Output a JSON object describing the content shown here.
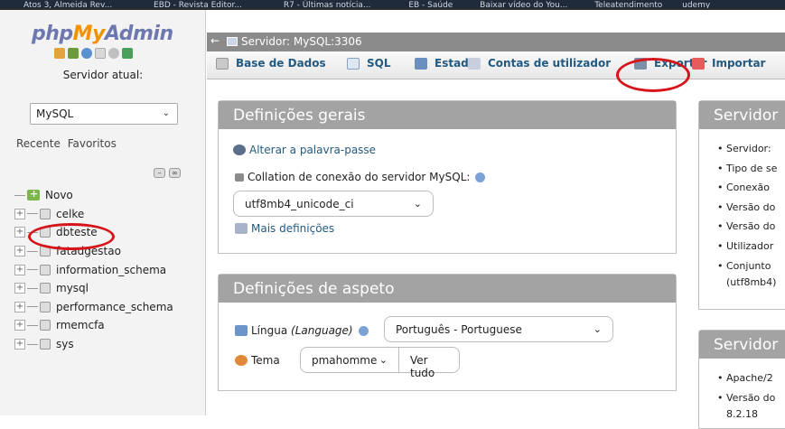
{
  "bookmarks": [
    "Atos 3, Almeida Rev...",
    "EBD - Revista Editor...",
    "R7 - Últimas notícia...",
    "EB - Saúde",
    "Baixar vídeo do You...",
    "Teleatendimento",
    "udemy"
  ],
  "nav": {
    "logo": {
      "php": "php",
      "my": "My",
      "admin": "Admin"
    },
    "server_label": "Servidor atual:",
    "server_value": "MySQL",
    "tab_recent": "Recente",
    "tab_favorites": "Favoritos",
    "tree": [
      {
        "name": "Novo",
        "type": "new"
      },
      {
        "name": "celke",
        "type": "db"
      },
      {
        "name": "dbteste",
        "type": "db"
      },
      {
        "name": "fatadgestao",
        "type": "db"
      },
      {
        "name": "information_schema",
        "type": "db"
      },
      {
        "name": "mysql",
        "type": "db"
      },
      {
        "name": "performance_schema",
        "type": "db"
      },
      {
        "name": "rmemcfa",
        "type": "db"
      },
      {
        "name": "sys",
        "type": "db"
      }
    ]
  },
  "breadcrumb": {
    "server": "Servidor: MySQL:3306"
  },
  "menu": {
    "tabs": [
      {
        "label": "Base de Dados",
        "icon": "database-icon"
      },
      {
        "label": "SQL",
        "icon": "sql-icon"
      },
      {
        "label": "Estado",
        "icon": "status-chart-icon"
      },
      {
        "label": "Contas de utilizador",
        "icon": "users-icon"
      },
      {
        "label": "Exportar",
        "icon": "export-icon"
      },
      {
        "label": "Importar",
        "icon": "import-icon"
      }
    ]
  },
  "general": {
    "title": "Definições gerais",
    "change_password": "Alterar a palavra-passe",
    "collation_label": "Collation de conexão do servidor MySQL:",
    "collation_value": "utf8mb4_unicode_ci",
    "more_settings": "Mais definições"
  },
  "appearance": {
    "title": "Definições de aspeto",
    "language_label": "Língua",
    "language_label_en": "(Language)",
    "language_value": "Português - Portuguese",
    "theme_label": "Tema",
    "theme_value": "pmahomme",
    "view_all": "Ver tudo"
  },
  "db_server": {
    "title": "Servidor",
    "items": [
      "Servidor:",
      "Tipo de se",
      "Conexão",
      "Versão do",
      "Versão do",
      "Utilizador",
      "Conjunto",
      "(utf8mb4)"
    ]
  },
  "web_server": {
    "title": "Servidor",
    "items": [
      "Apache/2",
      "Versão do",
      "8.2.18"
    ]
  },
  "colors": {
    "accent": "#235a81",
    "panel_header": "#a3a3a3",
    "annotation": "#d6151b"
  }
}
